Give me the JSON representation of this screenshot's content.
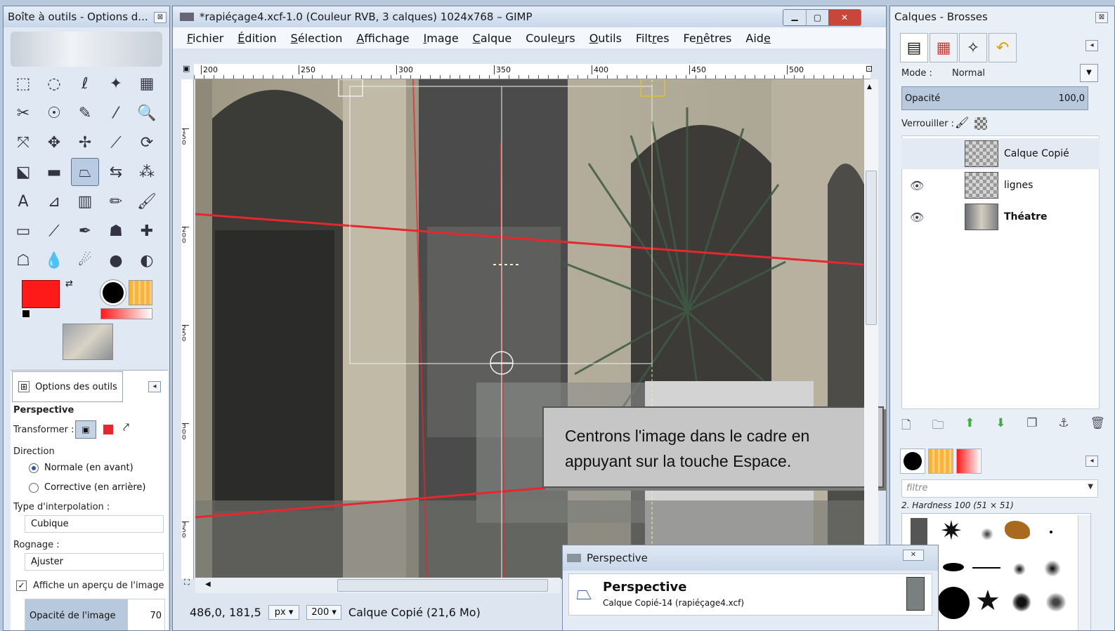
{
  "toolbox": {
    "title": "Boîte à outils - Options d...",
    "tool_icons": [
      "rect-select-icon",
      "ellipse-select-icon",
      "free-select-icon",
      "fuzzy-select-icon",
      "color-select-icon",
      "scissors-icon",
      "foreground-select-icon",
      "paths-icon",
      "color-picker-icon",
      "zoom-icon",
      "measure-icon",
      "move-icon",
      "align-icon",
      "crop-icon",
      "rotate-icon",
      "scale-icon",
      "shear-icon",
      "perspective-icon",
      "flip-icon",
      "cage-icon",
      "text-icon",
      "bucket-fill-icon",
      "gradient-icon",
      "pencil-icon",
      "paintbrush-icon",
      "eraser-icon",
      "airbrush-icon",
      "ink-icon",
      "clone-icon",
      "heal-icon",
      "perspective-clone-icon",
      "blur-icon",
      "smudge-icon",
      "dodge-icon",
      "burn-icon"
    ],
    "tool_glyphs": [
      "⬚",
      "◌",
      "ℓ",
      "✦",
      "▦",
      "✂",
      "☉",
      "✎",
      "⁄",
      "🔍",
      "⤧",
      "✥",
      "✢",
      "⟋",
      "⟳",
      "⬕",
      "▬",
      "⏢",
      "⇆",
      "⁂",
      "A",
      "⊿",
      "▥",
      "✏",
      "🖌",
      "▭",
      "⟋",
      "✒",
      "☗",
      "✚",
      "☖",
      "💧",
      "☄",
      "●",
      "◐"
    ],
    "selected_tool_index": 17,
    "fg_color": "#ff1a1a",
    "bg_color": "#ffffff",
    "options_tab": "Options des outils",
    "tool_name": "Perspective",
    "transform_label": "Transformer :",
    "direction_label": "Direction",
    "direction_options": [
      "Normale (en avant)",
      "Corrective (en arrière)"
    ],
    "direction_selected": 0,
    "interp_label": "Type d'interpolation :",
    "interp_value": "Cubique",
    "clip_label": "Rognage :",
    "clip_value": "Ajuster",
    "preview_label": "Affiche un aperçu de l'image",
    "preview_checked": true,
    "opacity_label": "Opacité de l'image",
    "opacity_value": "70"
  },
  "image_window": {
    "title": "*rapiéçage4.xcf-1.0 (Couleur RVB, 3 calques) 1024x768 – GIMP",
    "menus": [
      {
        "pre": "",
        "u": "F",
        "post": "ichier"
      },
      {
        "pre": "",
        "u": "É",
        "post": "dition"
      },
      {
        "pre": "",
        "u": "S",
        "post": "élection"
      },
      {
        "pre": "",
        "u": "A",
        "post": "ffichage"
      },
      {
        "pre": "",
        "u": "I",
        "post": "mage"
      },
      {
        "pre": "",
        "u": "C",
        "post": "alque"
      },
      {
        "pre": "Coule",
        "u": "u",
        "post": "rs"
      },
      {
        "pre": "",
        "u": "O",
        "post": "utils"
      },
      {
        "pre": "Filt",
        "u": "r",
        "post": "es"
      },
      {
        "pre": "Fe",
        "u": "n",
        "post": "êtres"
      },
      {
        "pre": "Aid",
        "u": "e",
        "post": ""
      }
    ],
    "ruler_labels": [
      "200",
      "250",
      "300",
      "350",
      "400",
      "450",
      "500"
    ],
    "vruler_labels": [
      "150",
      "200",
      "250",
      "300",
      "350"
    ],
    "coords": "486,0, 181,5",
    "unit": "px",
    "zoom": "200",
    "status_text": "Calque Copié (21,6 Mo)",
    "callout": "Centrons l'image dans le cadre en appuyant sur la touche Espace."
  },
  "layers_dock": {
    "title": "Calques - Brosses",
    "mode_label": "Mode :",
    "mode_value": "Normal",
    "opacity_label": "Opacité",
    "opacity_value": "100,0",
    "opacity_fraction": 1.0,
    "lock_label": "Verrouiller :",
    "layers": [
      {
        "name": "Calque Copié",
        "visible": false,
        "selected": true
      },
      {
        "name": "lignes",
        "visible": true,
        "selected": false
      },
      {
        "name": "Théatre",
        "visible": true,
        "selected": false
      }
    ],
    "filter_placeholder": "filtre",
    "brush_name": "2. Hardness 100 (51 × 51)"
  },
  "perspective_dialog": {
    "title": "Perspective",
    "heading": "Perspective",
    "subtitle": "Calque Copié-14 (rapiéçage4.xcf)"
  }
}
